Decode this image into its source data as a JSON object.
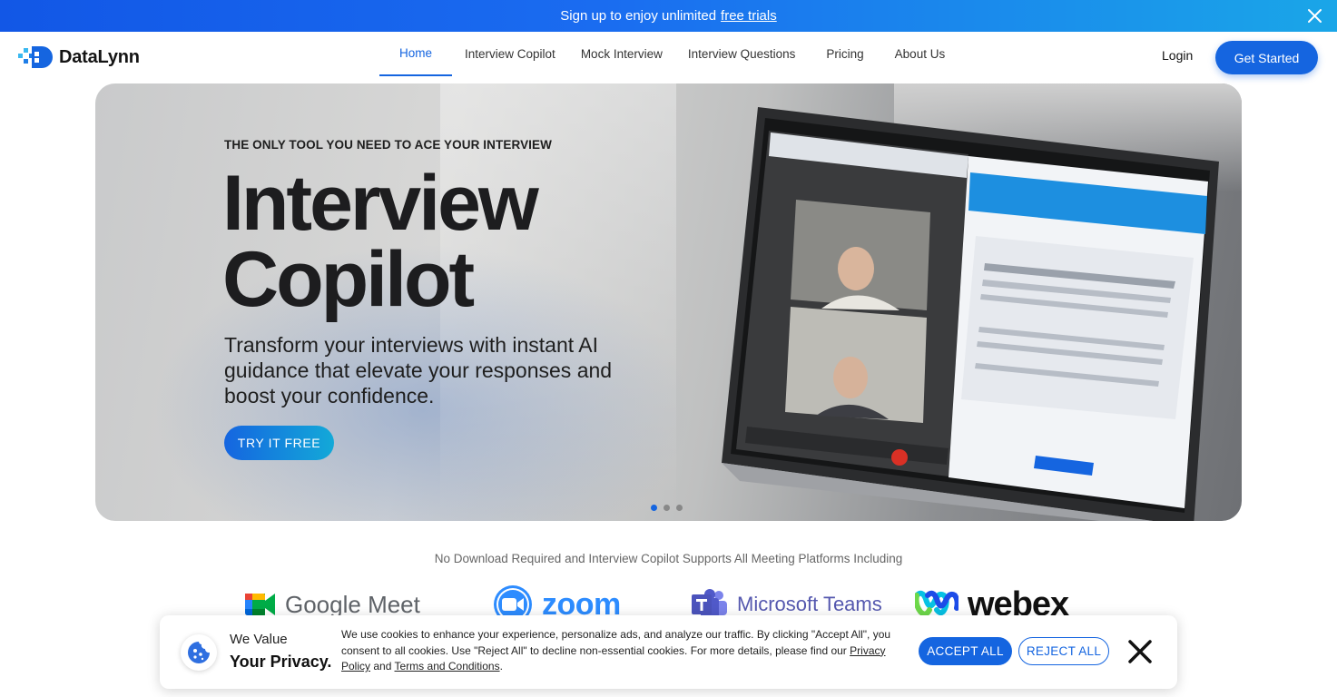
{
  "promo": {
    "text": "Sign up to enjoy unlimited",
    "link": "free trials"
  },
  "nav": {
    "brand": "DataLynn",
    "items": [
      {
        "label": "Home",
        "active": true
      },
      {
        "label": "Interview Copilot",
        "active": false
      },
      {
        "label": "Mock Interview",
        "active": false
      },
      {
        "label": "Interview Questions",
        "active": false
      },
      {
        "label": "Pricing",
        "active": false
      },
      {
        "label": "About Us",
        "active": false
      }
    ],
    "login": "Login",
    "cta": "Get Started"
  },
  "hero": {
    "eyebrow": "THE ONLY TOOL YOU NEED TO ACE YOUR INTERVIEW",
    "title_line1": "Interview",
    "title_line2": "Copilot",
    "subtitle": "Transform your interviews with instant AI guidance that elevate your responses and boost your confidence.",
    "cta": "TRY IT FREE",
    "slides": 3,
    "active_slide": 1
  },
  "platforms": {
    "caption": "No Download Required and Interview Copilot Supports All Meeting Platforms Including",
    "items": [
      "Google Meet",
      "zoom",
      "Microsoft Teams",
      "webex"
    ]
  },
  "cookie": {
    "heading_line1": "We Value",
    "heading_line2": "Your Privacy.",
    "text_part1": "We use cookies to enhance your experience, personalize ads, and analyze our traffic. By clicking \"Accept All\", you consent to all cookies. Use \"Reject All\" to decline non-essential cookies. For more details, please find our",
    "privacy_link": "Privacy Policy",
    "text_and": "and",
    "terms_link": "Terms and Conditions",
    "text_end": ".",
    "accept": "ACCEPT ALL",
    "reject": "REJECT ALL"
  },
  "colors": {
    "brand_blue": "#1565e0",
    "promo_start": "#1257e6",
    "promo_end": "#1aa6e8"
  },
  "icons": [
    "close-icon",
    "datalynn-logo-icon",
    "google-meet-icon",
    "zoom-icon",
    "microsoft-teams-icon",
    "webex-icon",
    "cookie-icon"
  ]
}
